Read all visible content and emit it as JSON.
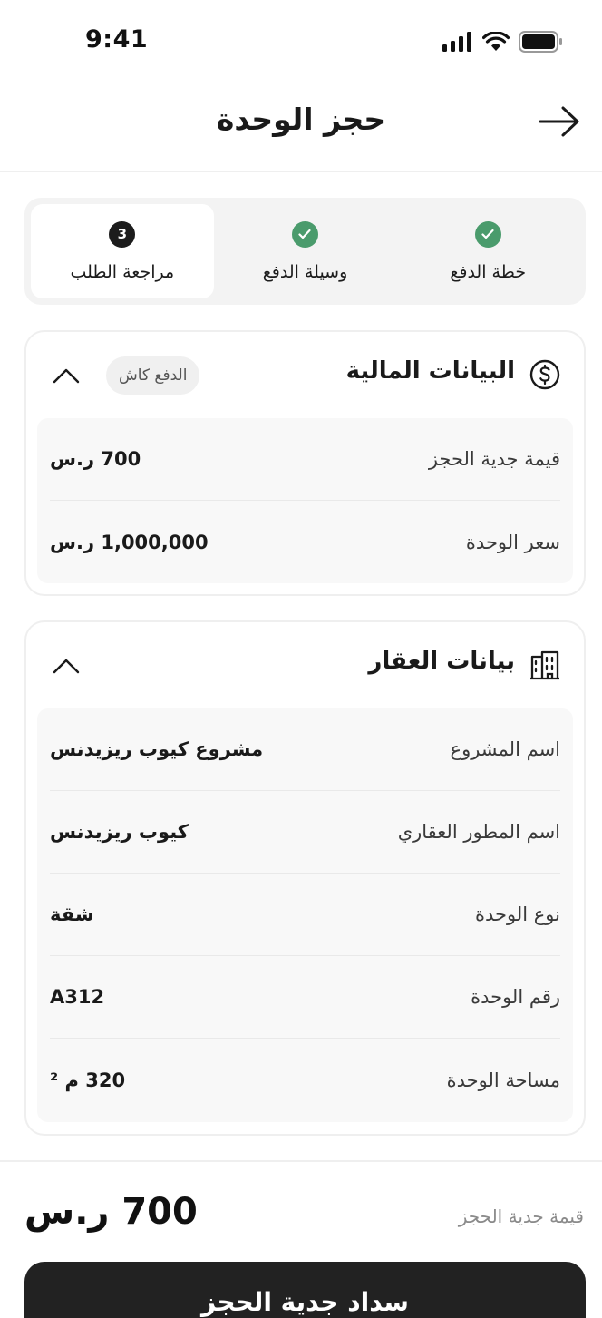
{
  "status_bar": {
    "time": "9:41"
  },
  "header": {
    "title": "حجز الوحدة"
  },
  "stepper": {
    "steps": [
      {
        "label": "خطة الدفع",
        "state": "done"
      },
      {
        "label": "وسيلة الدفع",
        "state": "done"
      },
      {
        "label": "مراجعة الطلب",
        "state": "current",
        "number": "3"
      }
    ]
  },
  "financial": {
    "title": "البيانات المالية",
    "badge": "الدفع كاش",
    "icon": "dollar-circle-icon",
    "rows": [
      {
        "label": "قيمة جدية الحجز",
        "value": "700 ر.س"
      },
      {
        "label": "سعر الوحدة",
        "value": "1,000,000 ر.س"
      }
    ]
  },
  "property": {
    "title": "بيانات العقار",
    "icon": "building-icon",
    "rows": [
      {
        "label": "اسم المشروع",
        "value": "مشروع كيوب ريزيدنس"
      },
      {
        "label": "اسم المطور العقاري",
        "value": "كيوب ريزيدنس"
      },
      {
        "label": "نوع الوحدة",
        "value": "شقة"
      },
      {
        "label": "رقم الوحدة",
        "value": "A312"
      },
      {
        "label": "مساحة الوحدة",
        "value": "320 م ²"
      }
    ]
  },
  "footer": {
    "total_label": "قيمة جدية الحجز",
    "total_amount": "700 ر.س",
    "pay_button_label": "سداد جدية الحجز"
  },
  "colors": {
    "accent": "#222222",
    "success": "#4a9b6c",
    "surface": "#f8f8f8"
  }
}
